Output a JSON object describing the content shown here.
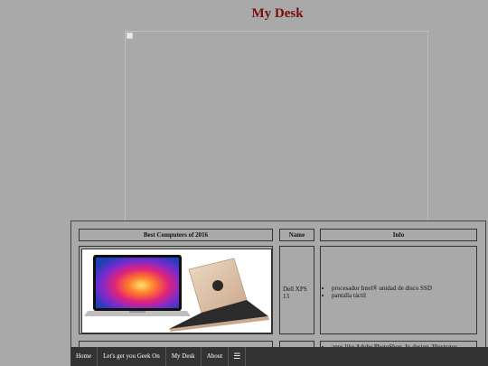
{
  "page": {
    "title": "My Desk"
  },
  "hero": {
    "image_state": "broken-image"
  },
  "table": {
    "headers": [
      "Best Computers of 2016",
      "Name",
      "Info"
    ],
    "rows": [
      {
        "name": "Dell XPS 13",
        "info": [
          "procesador Intel®   unidad de disco SSD",
          "pantalla táctil"
        ]
      },
      {
        "name": "",
        "info": [
          "apps like Adobe PhotoShop, In-design, Illustrator"
        ]
      }
    ]
  },
  "nav": {
    "items": [
      "Home",
      "Let's get you Geek On",
      "My Desk",
      "About"
    ],
    "menu_icon": "☰"
  },
  "colors": {
    "background": "#a9a9a9",
    "title": "#7a0d0d",
    "navbar": "#333333"
  }
}
